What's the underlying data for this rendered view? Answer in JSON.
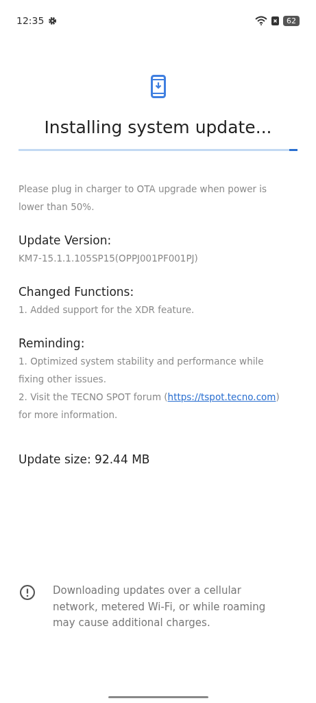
{
  "status_bar": {
    "time": "12:35",
    "battery": "62"
  },
  "title": "Installing system update...",
  "progress": {
    "level": 0.03
  },
  "notice": "Please plug in charger to OTA upgrade when power is lower than 50%.",
  "sections": [
    {
      "heading": "Update Version:",
      "items": [
        {
          "text": "KM7-15.1.1.105SP15(OPPJ001PF001PJ)"
        }
      ]
    },
    {
      "heading": "Changed Functions:",
      "items": [
        {
          "text": "1. Added support for the XDR feature."
        }
      ]
    },
    {
      "heading": "Reminding:",
      "items": [
        {
          "text": "1. Optimized system stability and performance while fixing other issues."
        },
        {
          "text": "2. Visit the TECNO SPOT forum (",
          "link": "https://tspot.tecno.com",
          "after": ") for more information."
        }
      ]
    }
  ],
  "update_size": "Update size: 92.44 MB",
  "warning": "Downloading updates over a cellular network, metered Wi-Fi, or while roaming may cause additional charges."
}
